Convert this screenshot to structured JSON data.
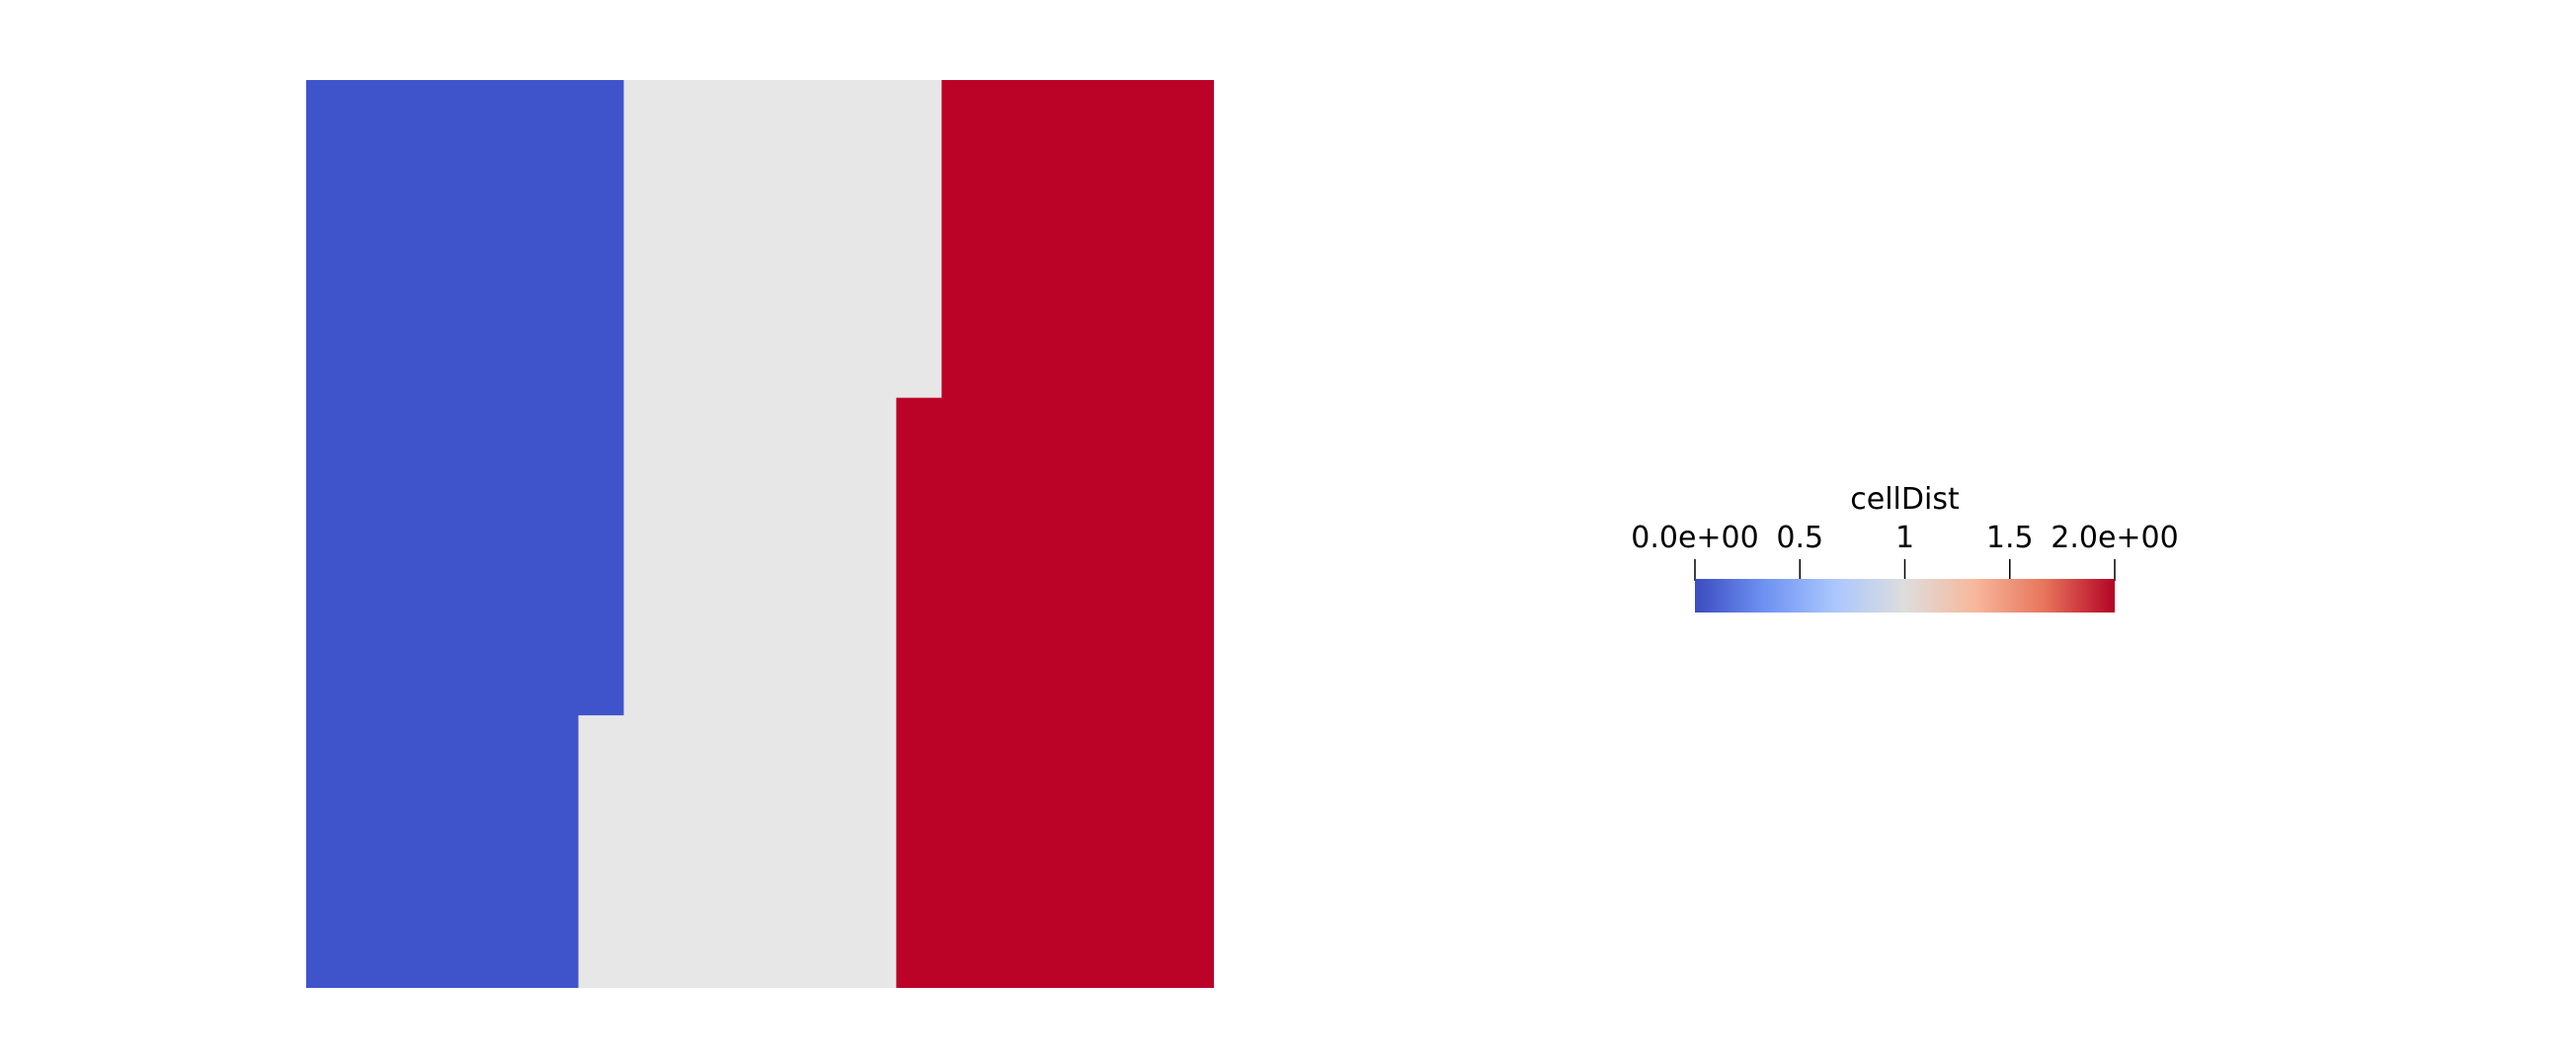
{
  "chart_data": {
    "type": "heatmap",
    "scalar_name": "cellDist",
    "domain_extent": [
      0,
      1
    ],
    "regions": [
      {
        "value": 0,
        "polygon": [
          [
            0,
            0
          ],
          [
            0.35,
            0
          ],
          [
            0.35,
            0.7
          ],
          [
            0.3,
            0.7
          ],
          [
            0.3,
            1
          ],
          [
            0,
            1
          ]
        ]
      },
      {
        "value": 1,
        "polygon": [
          [
            0.35,
            0
          ],
          [
            0.7,
            0
          ],
          [
            0.7,
            0.35
          ],
          [
            0.65,
            0.35
          ],
          [
            0.65,
            1
          ],
          [
            0.3,
            1
          ],
          [
            0.3,
            0.7
          ],
          [
            0.35,
            0.7
          ]
        ]
      },
      {
        "value": 2,
        "polygon": [
          [
            0.7,
            0
          ],
          [
            1,
            0
          ],
          [
            1,
            1
          ],
          [
            0.65,
            1
          ],
          [
            0.65,
            0.35
          ],
          [
            0.7,
            0.35
          ]
        ]
      }
    ],
    "colorbar": {
      "title": "cellDist",
      "range": [
        0,
        2
      ],
      "ticks": [
        {
          "value": 0,
          "label": "0.0e+00"
        },
        {
          "value": 0.5,
          "label": "0.5"
        },
        {
          "value": 1,
          "label": "1"
        },
        {
          "value": 1.5,
          "label": "1.5"
        },
        {
          "value": 2,
          "label": "2.0e+00"
        }
      ],
      "colormap": [
        "#3b4cc0",
        "#6f92f3",
        "#aac7fd",
        "#dddddd",
        "#f7b89c",
        "#e7745b",
        "#b40426"
      ]
    }
  },
  "colors": {
    "low": "#3f54cb",
    "mid": "#e7e7e7",
    "high": "#bb0328"
  }
}
